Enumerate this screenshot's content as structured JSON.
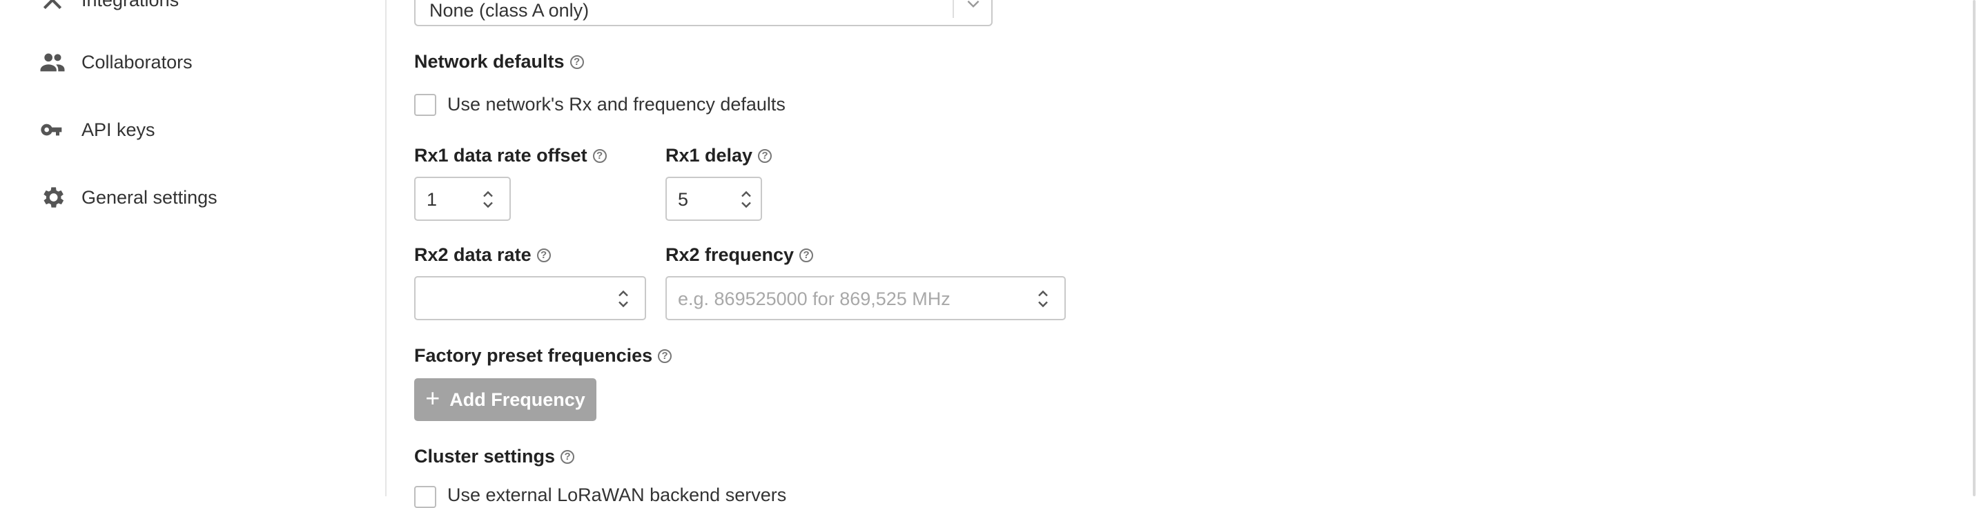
{
  "sidebar": {
    "items": [
      {
        "label": "Integrations",
        "icon": "integrations-icon"
      },
      {
        "label": "Collaborators",
        "icon": "collaborators-icon"
      },
      {
        "label": "API keys",
        "icon": "key-icon"
      },
      {
        "label": "General settings",
        "icon": "gear-icon"
      }
    ]
  },
  "form": {
    "class_select_value": "None (class A only)",
    "network_defaults": {
      "title": "Network defaults",
      "checkbox_label": "Use network's Rx and frequency defaults",
      "checked": false
    },
    "rx1_offset": {
      "label": "Rx1 data rate offset",
      "value": "1"
    },
    "rx1_delay": {
      "label": "Rx1 delay",
      "value": "5"
    },
    "rx2_data_rate": {
      "label": "Rx2 data rate",
      "value": ""
    },
    "rx2_frequency": {
      "label": "Rx2 frequency",
      "placeholder": "e.g. 869525000 for 869,525 MHz"
    },
    "factory_preset": {
      "label": "Factory preset frequencies",
      "button": "Add Frequency"
    },
    "cluster": {
      "title": "Cluster settings",
      "checkbox_label": "Use external LoRaWAN backend servers"
    }
  },
  "colors": {
    "button_disabled": "#a3a3a3",
    "border": "#c9c9c9"
  }
}
